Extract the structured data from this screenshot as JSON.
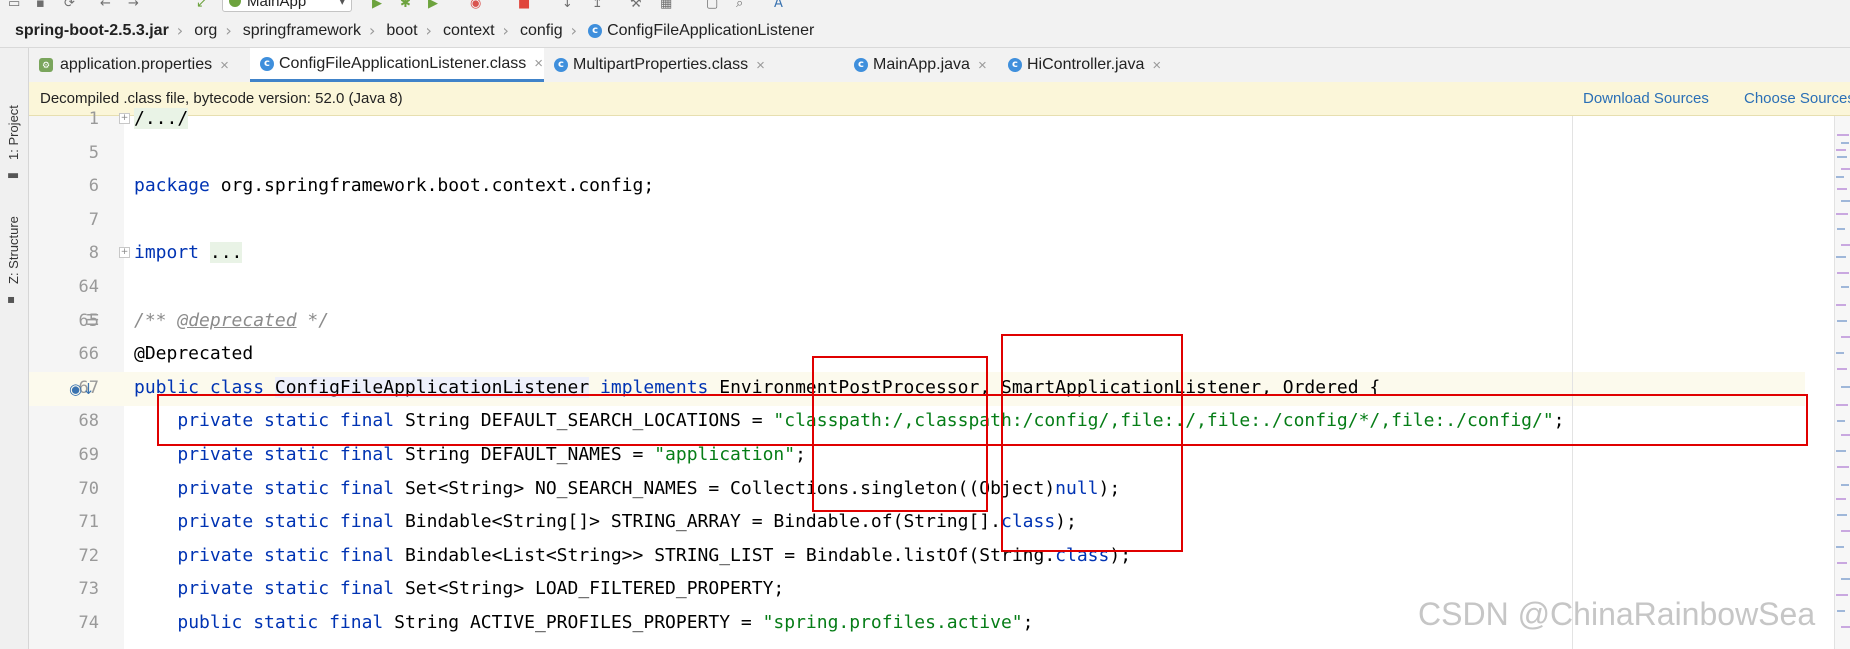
{
  "toolbar": {
    "run_config": "MainApp"
  },
  "breadcrumb": [
    "spring-boot-2.5.3.jar",
    "org",
    "springframework",
    "boot",
    "context",
    "config",
    "ConfigFileApplicationListener"
  ],
  "tool_windows": {
    "project": "1: Project",
    "structure": "Z: Structure"
  },
  "tabs": [
    {
      "label": "application.properties",
      "icon": "properties-file-icon",
      "active": false
    },
    {
      "label": "ConfigFileApplicationListener.class",
      "icon": "class-icon",
      "active": true
    },
    {
      "label": "MultipartProperties.class",
      "icon": "class-icon",
      "active": false
    },
    {
      "label": "MainApp.java",
      "icon": "class-icon",
      "active": false
    },
    {
      "label": "HiController.java",
      "icon": "class-icon",
      "active": false
    }
  ],
  "infobar": {
    "message": "Decompiled .class file, bytecode version: 52.0 (Java 8)",
    "download_sources": "Download Sources",
    "choose_sources": "Choose Sources..."
  },
  "code_lines": [
    {
      "n": "1",
      "html": "<span class=\"fold\">/.../</span>",
      "fold": true
    },
    {
      "n": "5",
      "html": ""
    },
    {
      "n": "6",
      "html": "<span class=\"k\">package</span> org.springframework.boot.context.config;"
    },
    {
      "n": "7",
      "html": ""
    },
    {
      "n": "8",
      "html": "<span class=\"k\">import</span> <span class=\"fold\">...</span>",
      "fold": true
    },
    {
      "n": "64",
      "html": ""
    },
    {
      "n": "65",
      "html": "<span class=\"c\">/** </span><span class=\"tag\">@deprecated</span><span class=\"c\"> */</span>",
      "doc": true
    },
    {
      "n": "66",
      "html": "@Deprecated"
    },
    {
      "n": "67",
      "html": "<span class=\"k\">public class</span> <span style=\"background:#eef0fb\">ConfigFileApplicationListener</span> <span class=\"k\">implements</span> EnvironmentPostProcessor, SmartApplicationListener, Ordered {",
      "caret": true,
      "override": true
    },
    {
      "n": "68",
      "html": "    <span class=\"k\">private static final</span> String DEFAULT_SEARCH_LOCATIONS = <span class=\"s\">\"classpath:/,classpath:/config/,file:./,file:./config/*/,file:./config/\"</span>;"
    },
    {
      "n": "69",
      "html": "    <span class=\"k\">private static final</span> String DEFAULT_NAMES = <span class=\"s\">\"application\"</span>;"
    },
    {
      "n": "70",
      "html": "    <span class=\"k\">private static final</span> Set&lt;String&gt; NO_SEARCH_NAMES = Collections.singleton((Object)<span class=\"k\">null</span>);"
    },
    {
      "n": "71",
      "html": "    <span class=\"k\">private static final</span> Bindable&lt;String[]&gt; STRING_ARRAY = Bindable.of(String[].<span class=\"k\">class</span>);"
    },
    {
      "n": "72",
      "html": "    <span class=\"k\">private static final</span> Bindable&lt;List&lt;String&gt;&gt; STRING_LIST = Bindable.listOf(String.<span class=\"k\">class</span>);"
    },
    {
      "n": "73",
      "html": "    <span class=\"k\">private static final</span> Set&lt;String&gt; LOAD_FILTERED_PROPERTY;"
    },
    {
      "n": "74",
      "html": "    <span class=\"k\">public static final</span> String ACTIVE_PROFILES_PROPERTY = <span class=\"s\">\"spring.profiles.active\"</span>;"
    }
  ],
  "watermark": "CSDN @ChinaRainbowSea",
  "colors": {
    "highlight_box": "#e00000",
    "keyword": "#0033b3",
    "string": "#067d17",
    "link": "#2a6fb6",
    "active_tab_underline": "#4083c9"
  }
}
